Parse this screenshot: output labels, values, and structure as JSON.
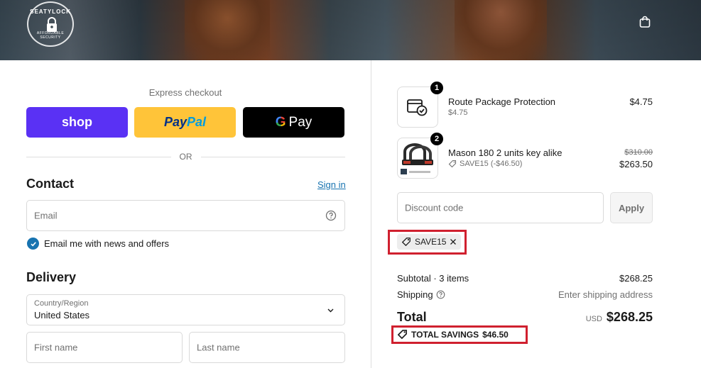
{
  "header": {
    "brand": "SEATYLOCK",
    "tagline": "AFFORDABLE SECURITY",
    "cart_icon": "shopping-bag-icon"
  },
  "express": {
    "title": "Express checkout",
    "shop_label": "shop",
    "paypal_label_1": "Pay",
    "paypal_label_2": "Pal",
    "gpay_g": "G",
    "gpay_label": "Pay",
    "or": "OR"
  },
  "contact": {
    "title": "Contact",
    "sign_in": "Sign in",
    "email_placeholder": "Email",
    "newsletter_label": "Email me with news and offers",
    "newsletter_checked": true
  },
  "delivery": {
    "title": "Delivery",
    "country_label": "Country/Region",
    "country_value": "United States",
    "first_name_placeholder": "First name",
    "last_name_placeholder": "Last name"
  },
  "order": {
    "items": [
      {
        "qty": "1",
        "name": "Route Package Protection",
        "sub": "$4.75",
        "price": "$4.75"
      },
      {
        "qty": "2",
        "name": "Mason 180 2 units key alike",
        "sub": "SAVE15 (-$46.50)",
        "original_price": "$310.00",
        "price": "$263.50"
      }
    ],
    "discount_placeholder": "Discount code",
    "apply_label": "Apply",
    "applied_code": "SAVE15",
    "subtotal_label": "Subtotal · 3 items",
    "subtotal_value": "$268.25",
    "shipping_label": "Shipping",
    "shipping_value": "Enter shipping address",
    "total_label": "Total",
    "currency": "USD",
    "total_value": "$268.25",
    "savings_label": "TOTAL SAVINGS",
    "savings_value": "$46.50"
  },
  "colors": {
    "shop_purple": "#5a31f4",
    "paypal_yellow": "#ffc439",
    "link_blue": "#1773b0",
    "highlight_red": "#d0202f"
  }
}
